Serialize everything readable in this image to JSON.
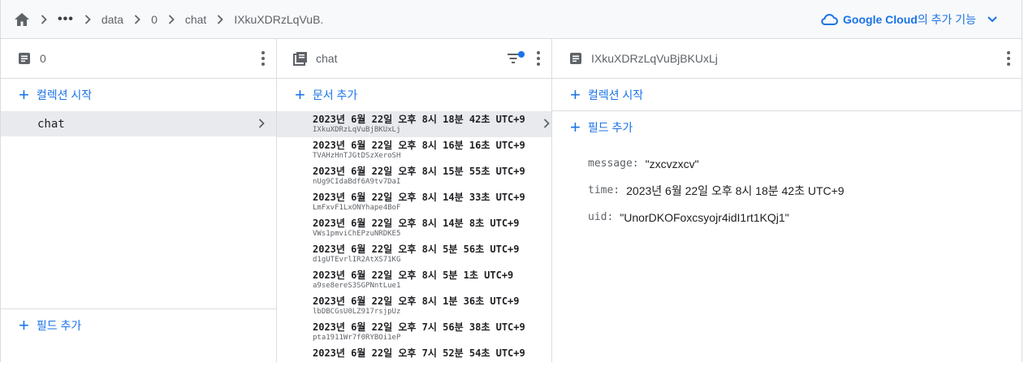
{
  "breadcrumb": {
    "more": "•••",
    "items": [
      "data",
      "0",
      "chat",
      "IXkuXDRzLqVuB."
    ]
  },
  "google_cloud": {
    "brand": "Google Cloud",
    "suffix": "의 추가 기능"
  },
  "col1": {
    "title": "0",
    "start_collection": "컬렉션 시작",
    "collections": [
      {
        "name": "chat"
      }
    ],
    "add_field": "필드 추가"
  },
  "col2": {
    "title": "chat",
    "add_document": "문서 추가",
    "documents": [
      {
        "date": "2023년 6월 22일 오후 8시 18분 42초 UTC+9",
        "id": "IXkuXDRzLqVuBjBKUxLj"
      },
      {
        "date": "2023년 6월 22일 오후 8시 16분 16초 UTC+9",
        "id": "TVAHzHnTJGtDSzXeroSH"
      },
      {
        "date": "2023년 6월 22일 오후 8시 15분 55초 UTC+9",
        "id": "nUg9CIdaBdf6A9tv7DaI"
      },
      {
        "date": "2023년 6월 22일 오후 8시 14분 33초 UTC+9",
        "id": "LmFxvF1LxONYhape4BoF"
      },
      {
        "date": "2023년 6월 22일 오후 8시 14분 8초 UTC+9",
        "id": "VWs1pmviChEPzuNRDKE5"
      },
      {
        "date": "2023년 6월 22일 오후 8시 5분 56초 UTC+9",
        "id": "d1gUTEvrlIR2AtXS71KG"
      },
      {
        "date": "2023년 6월 22일 오후 8시 5분 1초 UTC+9",
        "id": "a9se8ereS3SGPNntLue1"
      },
      {
        "date": "2023년 6월 22일 오후 8시 1분 36초 UTC+9",
        "id": "lbDBCGsU0LZ917rsjpUz"
      },
      {
        "date": "2023년 6월 22일 오후 7시 56분 38초 UTC+9",
        "id": "pta1911Wr7f0RYBOi1eP"
      },
      {
        "date": "2023년 6월 22일 오후 7시 52분 54초 UTC+9",
        "id": ""
      }
    ]
  },
  "col3": {
    "title": "IXkuXDRzLqVuBjBKUxLj",
    "start_collection": "컬렉션 시작",
    "add_field": "필드 추가",
    "fields": [
      {
        "key": "message:",
        "value": "\"zxcvzxcv\""
      },
      {
        "key": "time:",
        "value": "2023년 6월 22일 오후 8시 18분 42초 UTC+9"
      },
      {
        "key": "uid:",
        "value": "\"UnorDKOFoxcsyojr4idI1rt1KQj1\""
      }
    ]
  },
  "colors": {
    "accent": "#1a73e8",
    "selected_bg": "#e8eaed",
    "border": "#dadce0"
  }
}
